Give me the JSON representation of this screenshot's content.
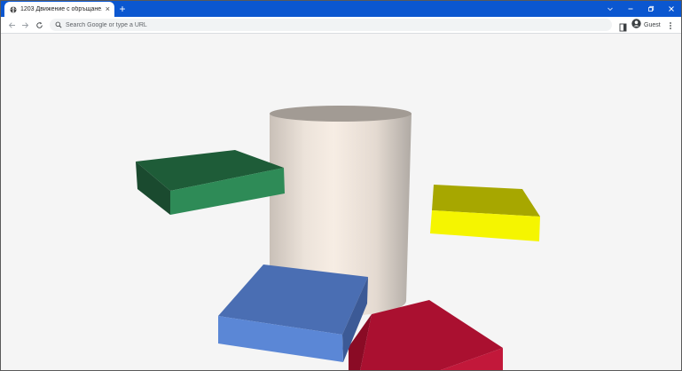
{
  "browser": {
    "tab": {
      "title": "1203 Движение с обръщане.html",
      "favicon": "globe-icon",
      "close_icon": "close-icon"
    },
    "new_tab_icon": "plus-icon",
    "window_controls": [
      "chevron-down-icon",
      "minimize-icon",
      "restore-icon",
      "close-icon"
    ],
    "toolbar": {
      "back_icon": "back-arrow-icon",
      "forward_icon": "forward-arrow-icon",
      "reload_icon": "reload-icon",
      "search_placeholder": "Search Google or type a URL",
      "profile_label": "Guest"
    },
    "colors": {
      "tab_strip": "#0b57d0",
      "background": "#f5f5f5"
    }
  },
  "scene": {
    "objects": [
      {
        "name": "cylinder",
        "color": "#e8ddd3"
      },
      {
        "name": "green-box",
        "color": "#2e8b57"
      },
      {
        "name": "yellow-box",
        "color": "#f5f500"
      },
      {
        "name": "blue-box",
        "color": "#5b87d6"
      },
      {
        "name": "red-box",
        "color": "#b0122e"
      }
    ]
  }
}
